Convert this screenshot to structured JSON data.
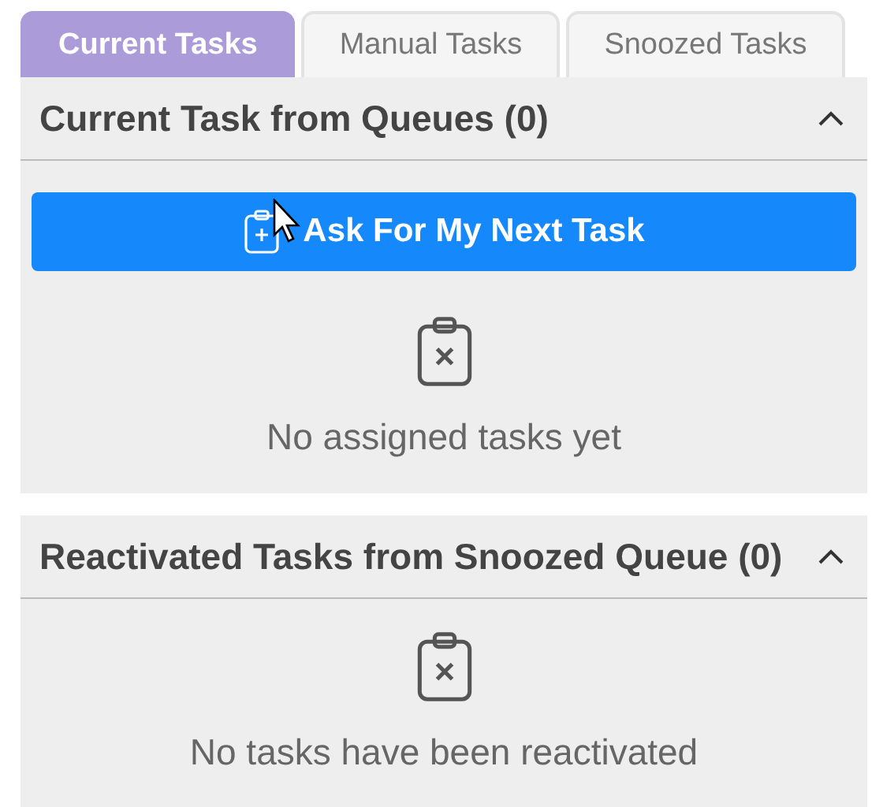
{
  "tabs": [
    {
      "label": "Current Tasks",
      "selected": true
    },
    {
      "label": "Manual Tasks",
      "selected": false
    },
    {
      "label": "Snoozed Tasks",
      "selected": false
    }
  ],
  "sections": [
    {
      "title": "Current Task from Queues (0)",
      "expanded": true,
      "button": "Ask For My Next Task",
      "empty_text": "No assigned tasks yet"
    },
    {
      "title": "Reactivated Tasks from Snoozed Queue (0)",
      "expanded": true,
      "empty_text": "No tasks have been reactivated"
    }
  ]
}
